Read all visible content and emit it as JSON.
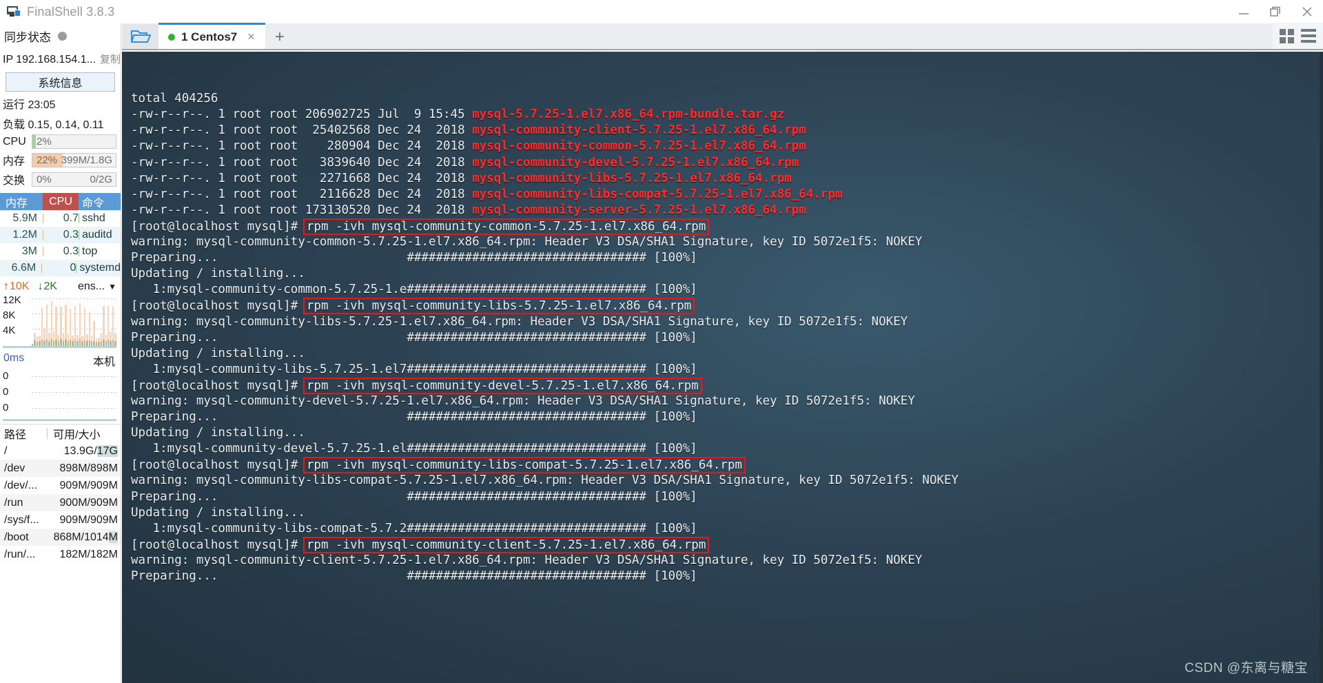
{
  "window": {
    "app_title": "FinalShell 3.8.3",
    "app_icon": "monitor-icon",
    "minimize": "minimize-icon",
    "maximize": "restore-icon",
    "close": "close-icon"
  },
  "sidebar": {
    "sync_label": "同步状态",
    "sync_status_icon": "status-dot-grey",
    "ip_label": "IP 192.168.154.1...",
    "copy_label": "复制",
    "system_info_button": "系统信息",
    "uptime": "运行 23:05",
    "load": "负载 0.15, 0.14, 0.11",
    "meters": [
      {
        "name": "CPU",
        "percent": "2%",
        "detail": "",
        "fill_pct": 4,
        "fill_color": "#9fd49f"
      },
      {
        "name": "内存",
        "percent": "22%",
        "detail": "399M/1.8G",
        "fill_pct": 36,
        "fill_color": "#f7cba6"
      },
      {
        "name": "交换",
        "percent": "0%",
        "detail": "0/2G",
        "fill_pct": 0,
        "fill_color": "#cfcfcf"
      }
    ],
    "process_table": {
      "headers": {
        "mem": "内存",
        "cpu": "CPU",
        "cmd": "命令"
      },
      "rows": [
        {
          "mem": "5.9M",
          "cpu": "0.7",
          "cmd": "sshd"
        },
        {
          "mem": "1.2M",
          "cpu": "0.3",
          "cmd": "auditd"
        },
        {
          "mem": "3M",
          "cpu": "0.3",
          "cmd": "top"
        },
        {
          "mem": "6.6M",
          "cpu": "0",
          "cmd": "systemd"
        }
      ]
    },
    "network": {
      "upload": "10K",
      "download": "2K",
      "interface": "ens...",
      "y_labels": [
        "12K",
        "8K",
        "4K"
      ],
      "bars": [
        0.06,
        0.3,
        0.22,
        0.24,
        0.86,
        0.4,
        0.93,
        0.3,
        1.0,
        0.34,
        0.88,
        0.26,
        0.88,
        0.3,
        0.93,
        0.28,
        0.84,
        0.24,
        0.9,
        0.26,
        0.96,
        0.22,
        0.86,
        0.28,
        0.76,
        0.24,
        0.56,
        0.18,
        0.2,
        0.3,
        0.9,
        0.26,
        0.9,
        0.34,
        0.88,
        0.3
      ],
      "bar_base": [
        0.1,
        0.14,
        0.11,
        0.12,
        0.16,
        0.13,
        0.17,
        0.12,
        0.18,
        0.13,
        0.16,
        0.12,
        0.17,
        0.13,
        0.16,
        0.12,
        0.15,
        0.12,
        0.16,
        0.12,
        0.17,
        0.11,
        0.15,
        0.13,
        0.14,
        0.12,
        0.12,
        0.1,
        0.1,
        0.12,
        0.16,
        0.12,
        0.16,
        0.13,
        0.15,
        0.12
      ]
    },
    "ping": {
      "latency": "0ms",
      "target": "本机",
      "y_labels": [
        "0",
        "0",
        "0"
      ]
    },
    "disk_table": {
      "headers": {
        "path": "路径",
        "size": "可用/大小"
      },
      "rows": [
        {
          "path": "/",
          "size": "13.9G/17G",
          "hl": "17G"
        },
        {
          "path": "/dev",
          "size": "898M/898M",
          "hl": ""
        },
        {
          "path": "/dev/...",
          "size": "909M/909M",
          "hl": ""
        },
        {
          "path": "/run",
          "size": "900M/909M",
          "hl": ""
        },
        {
          "path": "/sys/f...",
          "size": "909M/909M",
          "hl": ""
        },
        {
          "path": "/boot",
          "size": "868M/1014M",
          "hl": "M"
        },
        {
          "path": "/run/...",
          "size": "182M/182M",
          "hl": ""
        }
      ]
    }
  },
  "tabbar": {
    "folder_icon": "folder-open-icon",
    "tab_label": "1 Centos7",
    "tab_status_icon": "connected-dot-green",
    "tab_close": "×",
    "new_tab": "+",
    "grid_view_icon": "grid-view-icon",
    "list_view_icon": "list-view-icon"
  },
  "terminal": {
    "watermark": "CSDN @东离与糖宝",
    "lines": [
      {
        "text": "total 404256"
      },
      {
        "text": "-rw-r--r--. 1 root root 206902725 Jul  9 15:45 ",
        "file": "mysql-5.7.25-1.el7.x86_64.rpm-bundle.tar.gz"
      },
      {
        "text": "-rw-r--r--. 1 root root  25402568 Dec 24  2018 ",
        "file": "mysql-community-client-5.7.25-1.el7.x86_64.rpm"
      },
      {
        "text": "-rw-r--r--. 1 root root    280904 Dec 24  2018 ",
        "file": "mysql-community-common-5.7.25-1.el7.x86_64.rpm"
      },
      {
        "text": "-rw-r--r--. 1 root root   3839640 Dec 24  2018 ",
        "file": "mysql-community-devel-5.7.25-1.el7.x86_64.rpm"
      },
      {
        "text": "-rw-r--r--. 1 root root   2271668 Dec 24  2018 ",
        "file": "mysql-community-libs-5.7.25-1.el7.x86_64.rpm"
      },
      {
        "text": "-rw-r--r--. 1 root root   2116628 Dec 24  2018 ",
        "file": "mysql-community-libs-compat-5.7.25-1.el7.x86_64.rpm"
      },
      {
        "text": "-rw-r--r--. 1 root root 173130520 Dec 24  2018 ",
        "file": "mysql-community-server-5.7.25-1.el7.x86_64.rpm"
      },
      {
        "text": "[root@localhost mysql]# ",
        "boxed": "rpm -ivh mysql-community-common-5.7.25-1.el7.x86_64.rpm"
      },
      {
        "text": "warning: mysql-community-common-5.7.25-1.el7.x86_64.rpm: Header V3 DSA/SHA1 Signature, key ID 5072e1f5: NOKEY"
      },
      {
        "text": "Preparing...                          ################################# [100%]"
      },
      {
        "text": "Updating / installing..."
      },
      {
        "text": "   1:mysql-community-common-5.7.25-1.e################################# [100%]"
      },
      {
        "text": "[root@localhost mysql]# ",
        "boxed": "rpm -ivh mysql-community-libs-5.7.25-1.el7.x86_64.rpm"
      },
      {
        "text": "warning: mysql-community-libs-5.7.25-1.el7.x86_64.rpm: Header V3 DSA/SHA1 Signature, key ID 5072e1f5: NOKEY"
      },
      {
        "text": "Preparing...                          ################################# [100%]"
      },
      {
        "text": "Updating / installing..."
      },
      {
        "text": "   1:mysql-community-libs-5.7.25-1.el7################################# [100%]"
      },
      {
        "text": "[root@localhost mysql]# ",
        "boxed": "rpm -ivh mysql-community-devel-5.7.25-1.el7.x86_64.rpm"
      },
      {
        "text": "warning: mysql-community-devel-5.7.25-1.el7.x86_64.rpm: Header V3 DSA/SHA1 Signature, key ID 5072e1f5: NOKEY"
      },
      {
        "text": "Preparing...                          ################################# [100%]"
      },
      {
        "text": "Updating / installing..."
      },
      {
        "text": "   1:mysql-community-devel-5.7.25-1.el################################# [100%]"
      },
      {
        "text": "[root@localhost mysql]# ",
        "boxed": "rpm -ivh mysql-community-libs-compat-5.7.25-1.el7.x86_64.rpm"
      },
      {
        "text": "warning: mysql-community-libs-compat-5.7.25-1.el7.x86_64.rpm: Header V3 DSA/SHA1 Signature, key ID 5072e1f5: NOKEY"
      },
      {
        "text": "Preparing...                          ################################# [100%]"
      },
      {
        "text": "Updating / installing..."
      },
      {
        "text": "   1:mysql-community-libs-compat-5.7.2################################# [100%]"
      },
      {
        "text": "[root@localhost mysql]# ",
        "boxed": "rpm -ivh mysql-community-client-5.7.25-1.el7.x86_64.rpm"
      },
      {
        "text": "warning: mysql-community-client-5.7.25-1.el7.x86_64.rpm: Header V3 DSA/SHA1 Signature, key ID 5072e1f5: NOKEY"
      },
      {
        "text": "Preparing...                          ################################# [100%]"
      }
    ]
  },
  "colors": {
    "accent_blue": "#1e8fe0",
    "terminal_bg": "#2d4354",
    "file_red": "#ff2b2b",
    "box_red": "#f01414",
    "header_blue": "#5b9bd5",
    "header_red": "#c0504d"
  }
}
